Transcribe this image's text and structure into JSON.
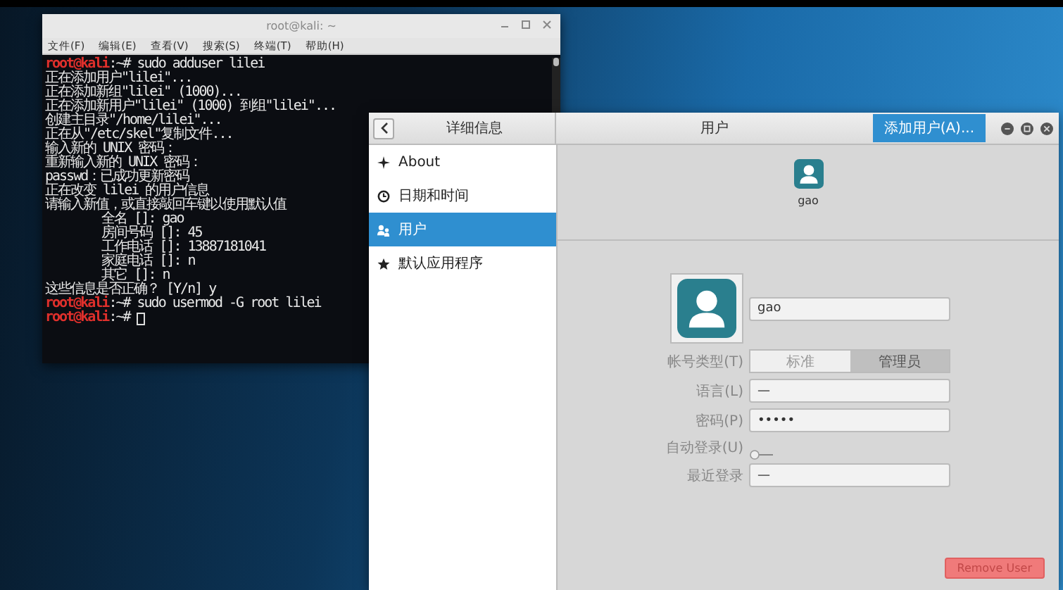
{
  "terminal": {
    "title": "root@kali: ~",
    "menu": [
      "文件(F)",
      "编辑(E)",
      "查看(V)",
      "搜索(S)",
      "终端(T)",
      "帮助(H)"
    ],
    "lines": [
      {
        "kind": "prompt",
        "user": "root@kali",
        "path": ":~#",
        "command": " sudo adduser lilei"
      },
      {
        "kind": "output",
        "text": "正在添加用户\"lilei\"..."
      },
      {
        "kind": "output",
        "text": "正在添加新组\"lilei\" (1000)..."
      },
      {
        "kind": "output",
        "text": "正在添加新用户\"lilei\" (1000) 到组\"lilei\"..."
      },
      {
        "kind": "output",
        "text": "创建主目录\"/home/lilei\"..."
      },
      {
        "kind": "output",
        "text": "正在从\"/etc/skel\"复制文件..."
      },
      {
        "kind": "output",
        "text": "输入新的 UNIX 密码："
      },
      {
        "kind": "output",
        "text": "重新输入新的 UNIX 密码："
      },
      {
        "kind": "output",
        "text": "passwd：已成功更新密码"
      },
      {
        "kind": "output",
        "text": "正在改变 lilei 的用户信息"
      },
      {
        "kind": "output",
        "text": "请输入新值，或直接敲回车键以使用默认值"
      },
      {
        "kind": "output",
        "text": "        全名 []: gao"
      },
      {
        "kind": "output",
        "text": "        房间号码 []: 45"
      },
      {
        "kind": "output",
        "text": "        工作电话 []: 13887181041"
      },
      {
        "kind": "output",
        "text": "        家庭电话 []: n"
      },
      {
        "kind": "output",
        "text": "        其它 []: n"
      },
      {
        "kind": "output",
        "text": "这些信息是否正确？ [Y/n] y"
      },
      {
        "kind": "prompt",
        "user": "root@kali",
        "path": ":~#",
        "command": " sudo usermod -G root lilei"
      },
      {
        "kind": "cursor_prompt",
        "user": "root@kali",
        "path": ":~#"
      }
    ]
  },
  "settings": {
    "sidebar_title": "详细信息",
    "title": "用户",
    "add_button": "添加用户(A)...",
    "sidebar_items": [
      {
        "label": "About",
        "selected": false
      },
      {
        "label": "日期和时间",
        "selected": false
      },
      {
        "label": "用户",
        "selected": true
      },
      {
        "label": "默认应用程序",
        "selected": false
      }
    ],
    "users": [
      {
        "name": "gao"
      }
    ],
    "name_field": {
      "value": "gao"
    },
    "rows": [
      {
        "kind": "segmented",
        "label": "帐号类型(T)",
        "options": [
          {
            "label": "标准",
            "selected": false
          },
          {
            "label": "管理员",
            "selected": true
          }
        ]
      },
      {
        "kind": "field",
        "label": "语言(L)",
        "value": "—"
      },
      {
        "kind": "field",
        "label": "密码(P)",
        "value": "•••••"
      },
      {
        "kind": "switch",
        "label": "自动登录(U)",
        "on": false
      },
      {
        "kind": "field",
        "label": "最近登录",
        "value": "—"
      }
    ],
    "remove_button": "Remove User"
  }
}
